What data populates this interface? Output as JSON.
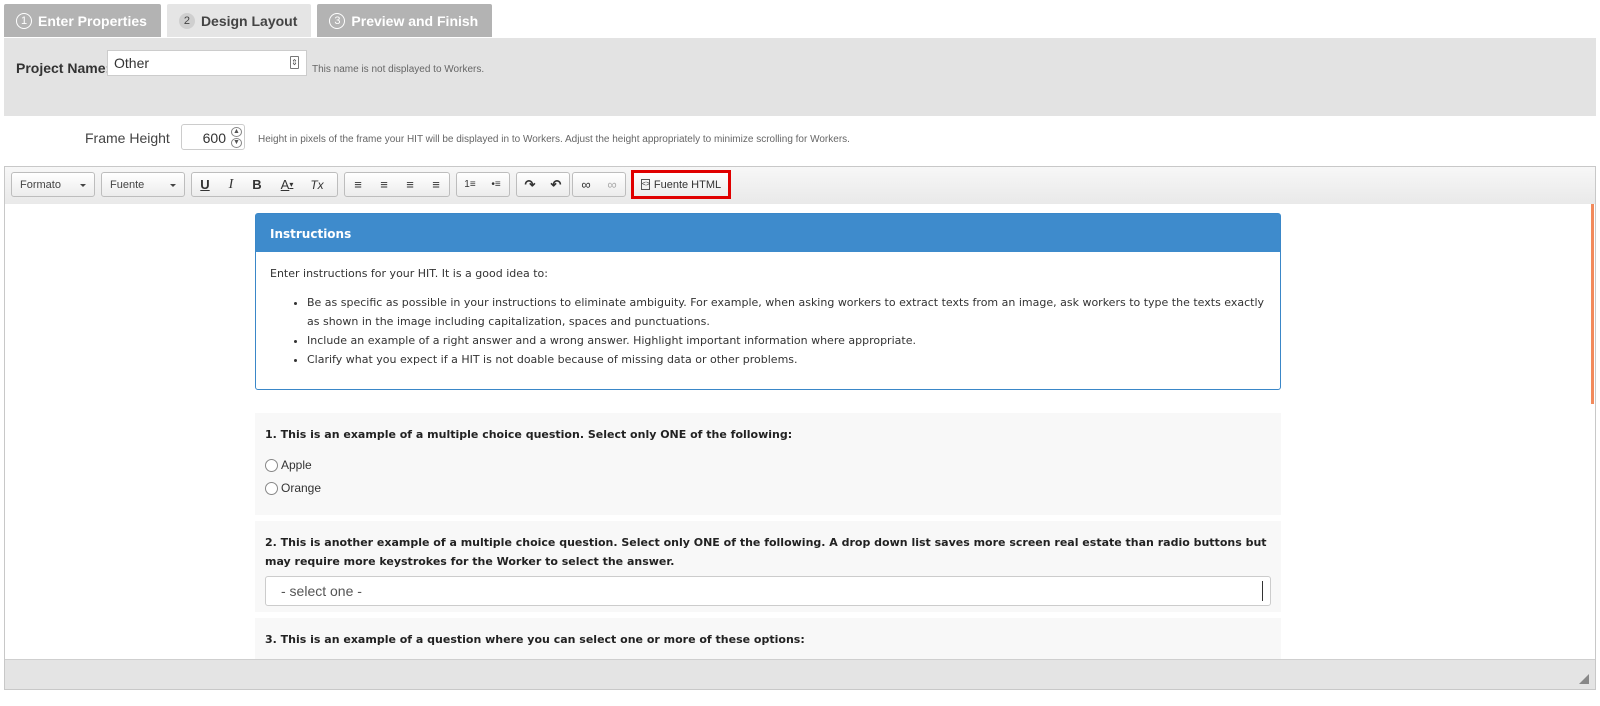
{
  "tabs": [
    {
      "num": "1",
      "label": "Enter Properties",
      "state": "inactive"
    },
    {
      "num": "2",
      "label": "Design Layout",
      "state": "active"
    },
    {
      "num": "3",
      "label": "Preview and Finish",
      "state": "inactive"
    }
  ],
  "project": {
    "label": "Project Name:",
    "value": "Other",
    "hint": "This name is not displayed to Workers."
  },
  "frame": {
    "label": "Frame Height",
    "value": "600",
    "hint": "Height in pixels of the frame your HIT will be displayed in to Workers. Adjust the height appropriately to minimize scrolling for Workers."
  },
  "toolbar": {
    "format_label": "Formato",
    "font_label": "Fuente",
    "source_label": "Fuente HTML",
    "buttons": {
      "underline": "U",
      "italic": "I",
      "bold": "B",
      "text_color": "A",
      "remove_format": "Tx",
      "align_left": "≡",
      "align_center": "≡",
      "align_right": "≡",
      "justify": "≡",
      "numbered_list": "1≡",
      "bulleted_list": "•≡",
      "redo": "↷",
      "undo": "↶",
      "link": "∞",
      "unlink": "∞"
    },
    "accent_color": "#e00000"
  },
  "instructions": {
    "heading": "Instructions",
    "intro": "Enter instructions for your HIT. It is a good idea to:",
    "items": [
      "Be as specific as possible in your instructions to eliminate ambiguity. For example, when asking workers to extract texts from an image, ask workers to type the texts exactly as shown in the image including capitalization, spaces and punctuations.",
      "Include an example of a right answer and a wrong answer. Highlight important information where appropriate.",
      "Clarify what you expect if a HIT is not doable because of missing data or other problems."
    ],
    "header_color": "#3e8bcc"
  },
  "questions": {
    "q1": {
      "title": "1. This is an example of a multiple choice question. Select only ONE of the following:",
      "options": [
        "Apple",
        "Orange"
      ]
    },
    "q2": {
      "title": "2. This is another example of a multiple choice question. Select only ONE of the following. A drop down list saves more screen real estate than radio buttons but may require more keystrokes for the Worker to select the answer.",
      "select_value": "- select one -"
    },
    "q3": {
      "title": "3. This is an example of a question where you can select one or more of these options:"
    }
  }
}
